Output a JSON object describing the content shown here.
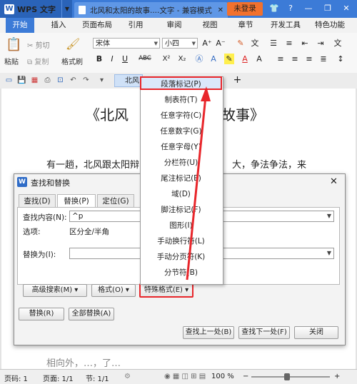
{
  "titlebar": {
    "app_name": "WPS 文字",
    "logo_letter": "W",
    "doc_tab_title": "北风和太阳的故事....文字 - 兼容模式",
    "login_label": "未登录"
  },
  "ribbon_tabs": [
    "开始",
    "插入",
    "页面布局",
    "引用",
    "审阅",
    "视图",
    "章节",
    "开发工具",
    "特色功能"
  ],
  "ribbon": {
    "paste_label": "粘贴",
    "cut_label": "剪切",
    "copy_label": "复制",
    "format_painter_label": "格式刷",
    "font_name": "宋体",
    "font_size": "小四",
    "bold": "B",
    "italic": "I",
    "underline": "U",
    "strike": "ABC",
    "superscript": "X²",
    "subscript": "X₂"
  },
  "quickbar": {
    "doc_tab_label": "北风"
  },
  "document": {
    "title_left": "《北风",
    "title_right": "故事》",
    "para_left": "有一趟，北风跟太阳辩",
    "para_right": "大，争法争法，来",
    "bottom_text": "相向外，…，了…"
  },
  "dialog": {
    "title": "查找和替换",
    "tabs": [
      "查找(D)",
      "替换(P)",
      "定位(G)"
    ],
    "find_label": "查找内容(N):",
    "find_value": "^p",
    "options_label": "选项:",
    "options_value": "区分全/半角",
    "replace_label": "替换为(I):",
    "replace_value": "",
    "advanced_search_btn": "高级搜索(M) ▾",
    "format_btn": "格式(O) ▾",
    "special_format_btn": "特殊格式(E) ▾",
    "replace_btn": "替换(R)",
    "replace_all_btn": "全部替换(A)",
    "find_prev_btn": "查找上一处(B)",
    "find_next_btn": "查找下一处(F)",
    "close_btn": "关闭"
  },
  "menu": {
    "items": [
      "段落标记(P)",
      "制表符(T)",
      "任意字符(C)",
      "任意数字(G)",
      "任意字母(Y)",
      "分栏符(U)",
      "尾注标记(E)",
      "域(D)",
      "脚注标记(F)",
      "图形(I)",
      "手动换行符(L)",
      "手动分页符(K)",
      "分节符(B)"
    ]
  },
  "statusbar": {
    "page_code": "页码: 1",
    "page_count": "页面: 1/1",
    "section": "节: 1/1",
    "zoom": "100 %"
  },
  "colors": {
    "title_blue": "#3c7bd7",
    "login_orange": "#f2712e",
    "highlight_red": "#e8262b"
  }
}
